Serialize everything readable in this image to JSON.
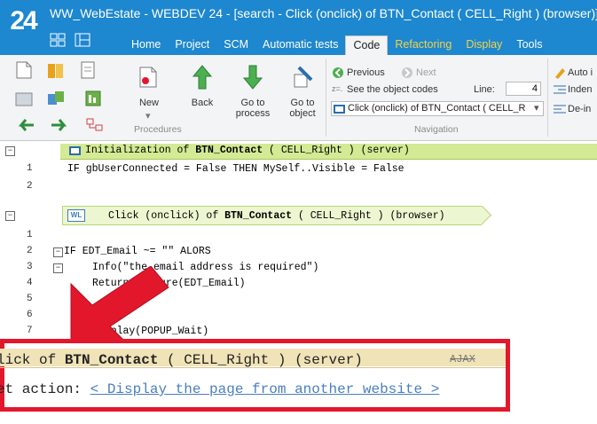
{
  "window": {
    "logo": "24",
    "title": "WW_WebEstate - WEBDEV 24 - [search - Click (onclick) of BTN_Contact ( CELL_Right ) (browser)]"
  },
  "ribbon_tabs": [
    {
      "label": "Home"
    },
    {
      "label": "Project"
    },
    {
      "label": "SCM"
    },
    {
      "label": "Automatic tests"
    },
    {
      "label": "Code"
    },
    {
      "label": "Refactoring"
    },
    {
      "label": "Display"
    },
    {
      "label": "Tools"
    }
  ],
  "ribbon": {
    "new_label": "New",
    "back_label": "Back",
    "goto_process_label": "Go to\nprocess",
    "goto_object_label": "Go to\nobject",
    "procedures_group": "Procedures",
    "previous_label": "Previous",
    "next_label": "Next",
    "see_codes_label": "See the object codes",
    "line_label": "Line:",
    "line_value": "4",
    "event_combo_value": "Click (onclick) of BTN_Contact ( CELL_R",
    "navigation_group": "Navigation",
    "auto_label": "Auto i",
    "indent_label": "Inden",
    "deindent_label": "De-in"
  },
  "editor": {
    "header1": {
      "prefix": "Initialization of ",
      "object": "BTN_Contact",
      "suffix": " ( CELL_Right ) (server)"
    },
    "block1_lines": [
      {
        "num": "1",
        "text": "IF gbUserConnected = False THEN MySelf..Visible = False"
      },
      {
        "num": "2",
        "text": ""
      }
    ],
    "header2": {
      "badge": "WL",
      "prefix": "Click (onclick) of ",
      "object": "BTN_Contact",
      "suffix": " ( CELL_Right ) (browser)"
    },
    "block2_lines": [
      {
        "num": "1",
        "text": ""
      },
      {
        "num": "2",
        "text": "IF EDT_Email ~= \"\" ALORS"
      },
      {
        "num": "3",
        "text": "Info(\"the email address is required\")"
      },
      {
        "num": "4",
        "text": "Return(Capture(EDT_Email)"
      },
      {
        "num": "5",
        "text": ""
      },
      {
        "num": "6",
        "text": ""
      },
      {
        "num": "7",
        "text": "Display(POPUP_Wait)"
      }
    ]
  },
  "callout": {
    "row1_prefix": "lick of ",
    "row1_object": "BTN_Contact",
    "row1_suffix": " ( CELL_Right ) (server)",
    "ajax_label": "AJAX",
    "row2_prefix": "et action: ",
    "row2_link": "< Display the page from another website >"
  },
  "colors": {
    "title_bar": "#1d87cf",
    "highlight_box": "#e3172c",
    "arrow": "#e3172c",
    "header_green": "#d4ea94"
  }
}
